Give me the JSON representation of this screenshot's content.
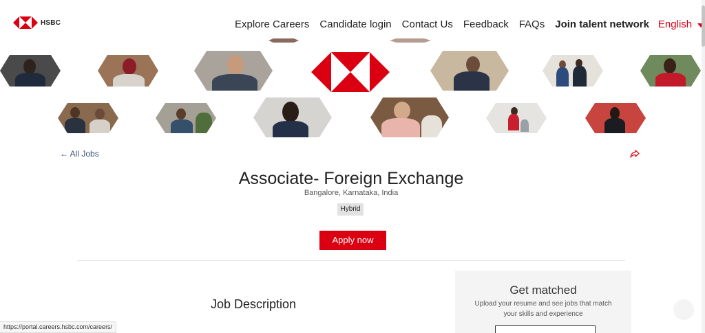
{
  "brand": {
    "name": "HSBC",
    "accent_color": "#db0011"
  },
  "nav": {
    "items": [
      "Explore Careers",
      "Candidate login",
      "Contact Us",
      "Feedback",
      "FAQs",
      "Join talent network"
    ],
    "language": "English"
  },
  "job": {
    "back_label": "← All Jobs",
    "title": "Associate- Foreign Exchange",
    "location": "Bangalore, Karnataka, India",
    "work_type": "Hybrid",
    "apply_label": "Apply now",
    "description_heading": "Job Description"
  },
  "get_matched": {
    "title": "Get matched",
    "text": "Upload your resume and see jobs that match your skills and experience"
  },
  "status_bar": {
    "url": "https://portal.careers.hsbc.com/careers/"
  },
  "icons": [
    "hsbc-logo-icon",
    "chevron-down-icon",
    "share-icon",
    "chat-icon"
  ]
}
